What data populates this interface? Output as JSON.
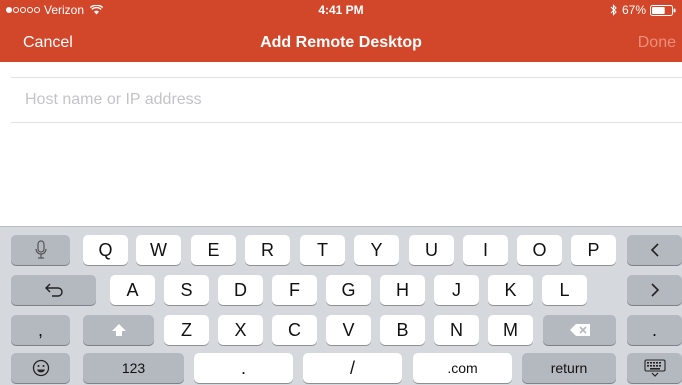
{
  "status_bar": {
    "carrier": "Verizon",
    "time": "4:41 PM",
    "battery": "67%",
    "battery_level": 0.67,
    "signal_bars_filled": 1,
    "signal_bars_total": 5,
    "icons": [
      "wifi-icon",
      "bluetooth-icon",
      "battery-icon"
    ]
  },
  "nav": {
    "cancel_label": "Cancel",
    "title": "Add Remote Desktop",
    "done_label": "Done"
  },
  "form": {
    "host": {
      "value": "",
      "placeholder": "Host name or IP address"
    }
  },
  "keyboard": {
    "row1": [
      "Q",
      "W",
      "E",
      "R",
      "T",
      "Y",
      "U",
      "I",
      "O",
      "P"
    ],
    "row2": [
      "A",
      "S",
      "D",
      "F",
      "G",
      "H",
      "J",
      "K",
      "L"
    ],
    "row3": [
      "Z",
      "X",
      "C",
      "V",
      "B",
      "N",
      "M"
    ],
    "comma": ",",
    "period_right": ".",
    "numbers_label": "123",
    "period_bottom": ".",
    "slash": "/",
    "dotcom": ".com",
    "return_label": "return",
    "icons": [
      "microphone-icon",
      "backspace-icon",
      "undo-icon",
      "forward-icon",
      "shift-icon",
      "delete-icon",
      "emoji-icon",
      "hide-keyboard-icon"
    ]
  },
  "colors": {
    "brand": "#d2462a",
    "done_disabled": "#ea8f7b",
    "placeholder": "#c4c4c8",
    "keyboard_bg": "#d5d8dd",
    "key_fn": "#b4b8bf"
  }
}
